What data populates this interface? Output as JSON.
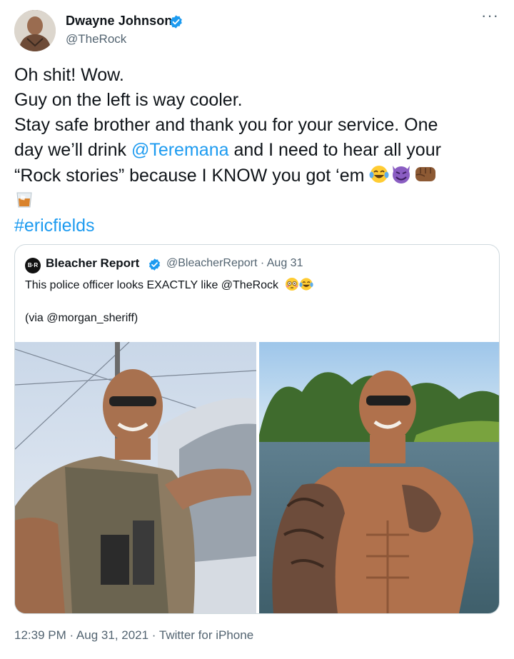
{
  "tweet": {
    "author_name": "Dwayne Johnson",
    "author_handle": "@TheRock",
    "more_label": "···",
    "text": {
      "line1": "Oh shit! Wow.",
      "line2": "Guy on the left is way cooler.",
      "line3": "Stay safe brother and thank you for your service. One",
      "line4_pre": "day we’ll drink ",
      "line4_mention": "@Teremana",
      "line4_post": " and I need to hear all your",
      "line5": "“Rock stories” because I KNOW you got ‘em",
      "hashtag": "#ericfields"
    },
    "emojis": [
      "tears-of-joy",
      "smiling-imp",
      "oncoming-fist",
      "tumbler-glass"
    ]
  },
  "quote": {
    "logo_text": "B·R",
    "author_name": "Bleacher Report",
    "author_handle": "@BleacherReport · Aug 31",
    "text_line1": "This police officer looks EXACTLY like @TheRock",
    "text_line2": "(via @morgan_sheriff)",
    "emojis": [
      "flushed-face",
      "tears-of-joy"
    ]
  },
  "footer": {
    "timestamp": "12:39 PM · Aug 31, 2021 · Twitter for iPhone"
  },
  "colors": {
    "link": "#1d9bf0",
    "secondary_text": "#536471",
    "border": "#cfd9de",
    "verified": "#1d9bf0"
  }
}
